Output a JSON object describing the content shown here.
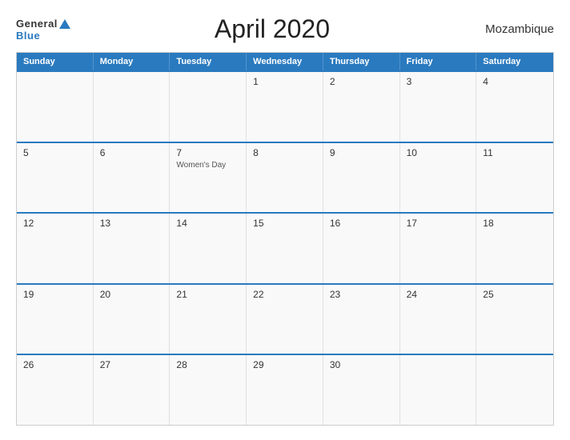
{
  "header": {
    "logo_general": "General",
    "logo_blue": "Blue",
    "title": "April 2020",
    "country": "Mozambique"
  },
  "calendar": {
    "weekdays": [
      "Sunday",
      "Monday",
      "Tuesday",
      "Wednesday",
      "Thursday",
      "Friday",
      "Saturday"
    ],
    "weeks": [
      [
        {
          "day": "",
          "event": ""
        },
        {
          "day": "",
          "event": ""
        },
        {
          "day": "",
          "event": ""
        },
        {
          "day": "1",
          "event": ""
        },
        {
          "day": "2",
          "event": ""
        },
        {
          "day": "3",
          "event": ""
        },
        {
          "day": "4",
          "event": ""
        }
      ],
      [
        {
          "day": "5",
          "event": ""
        },
        {
          "day": "6",
          "event": ""
        },
        {
          "day": "7",
          "event": "Women's Day"
        },
        {
          "day": "8",
          "event": ""
        },
        {
          "day": "9",
          "event": ""
        },
        {
          "day": "10",
          "event": ""
        },
        {
          "day": "11",
          "event": ""
        }
      ],
      [
        {
          "day": "12",
          "event": ""
        },
        {
          "day": "13",
          "event": ""
        },
        {
          "day": "14",
          "event": ""
        },
        {
          "day": "15",
          "event": ""
        },
        {
          "day": "16",
          "event": ""
        },
        {
          "day": "17",
          "event": ""
        },
        {
          "day": "18",
          "event": ""
        }
      ],
      [
        {
          "day": "19",
          "event": ""
        },
        {
          "day": "20",
          "event": ""
        },
        {
          "day": "21",
          "event": ""
        },
        {
          "day": "22",
          "event": ""
        },
        {
          "day": "23",
          "event": ""
        },
        {
          "day": "24",
          "event": ""
        },
        {
          "day": "25",
          "event": ""
        }
      ],
      [
        {
          "day": "26",
          "event": ""
        },
        {
          "day": "27",
          "event": ""
        },
        {
          "day": "28",
          "event": ""
        },
        {
          "day": "29",
          "event": ""
        },
        {
          "day": "30",
          "event": ""
        },
        {
          "day": "",
          "event": ""
        },
        {
          "day": "",
          "event": ""
        }
      ]
    ]
  }
}
